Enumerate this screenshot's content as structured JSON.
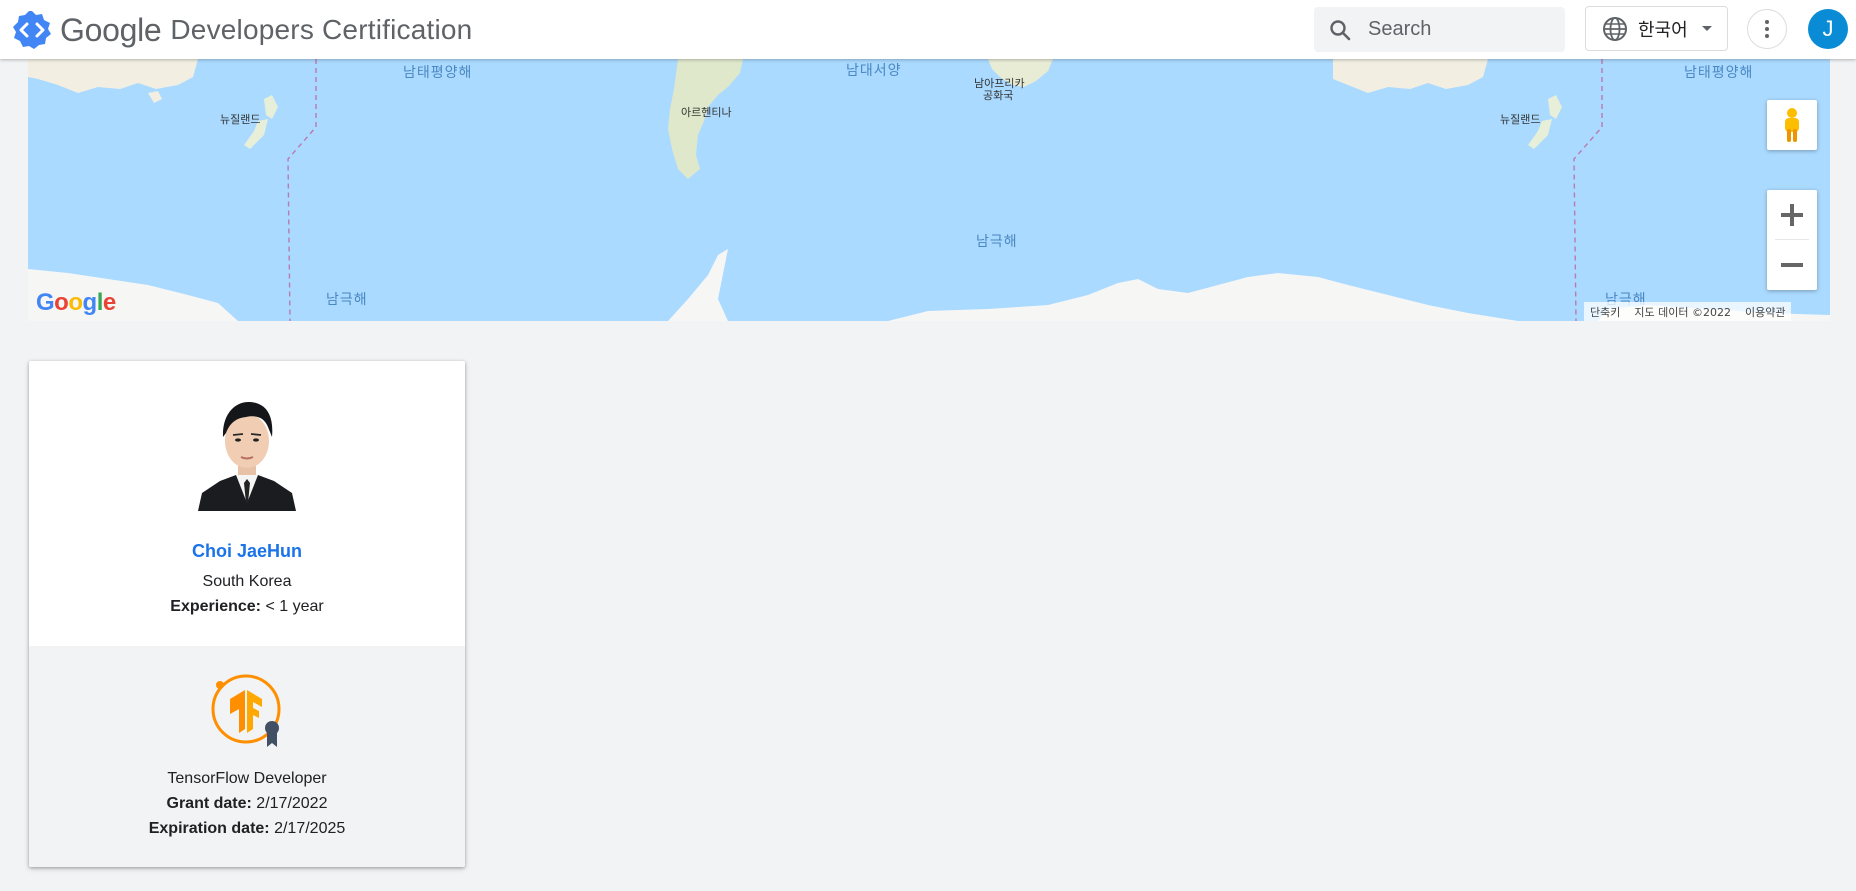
{
  "header": {
    "brand_google": "Google",
    "brand_rest": "Developers Certification",
    "search_placeholder": "Search",
    "language": "한국어",
    "avatar_initial": "J",
    "avatar_color": "#0a8bd6"
  },
  "map": {
    "labels": {
      "south_pacific_left": "남태평양해",
      "south_atlantic": "남대서양",
      "south_pacific_right": "남태평양해",
      "southern_ocean_center": "남극해",
      "southern_ocean_left": "남극해",
      "southern_ocean_right": "남극해",
      "new_zealand_left": "뉴질랜드",
      "new_zealand_right": "뉴질랜드",
      "argentina": "아르헨티나",
      "south_africa_line1": "남아프리카",
      "south_africa_line2": "공화국"
    },
    "logo": "Google",
    "attribution": {
      "shortcuts": "단축키",
      "data": "지도 데이터 ©2022",
      "terms": "이용약관"
    },
    "water_color": "#aadaff"
  },
  "profile": {
    "name": "Choi JaeHun",
    "country": "South Korea",
    "experience_label": "Experience:",
    "experience_value": "< 1 year"
  },
  "certification": {
    "name": "TensorFlow Developer",
    "grant_label": "Grant date:",
    "grant_value": "2/17/2022",
    "expiration_label": "Expiration date:",
    "expiration_value": "2/17/2025",
    "badge_color": "#ff8f00"
  }
}
